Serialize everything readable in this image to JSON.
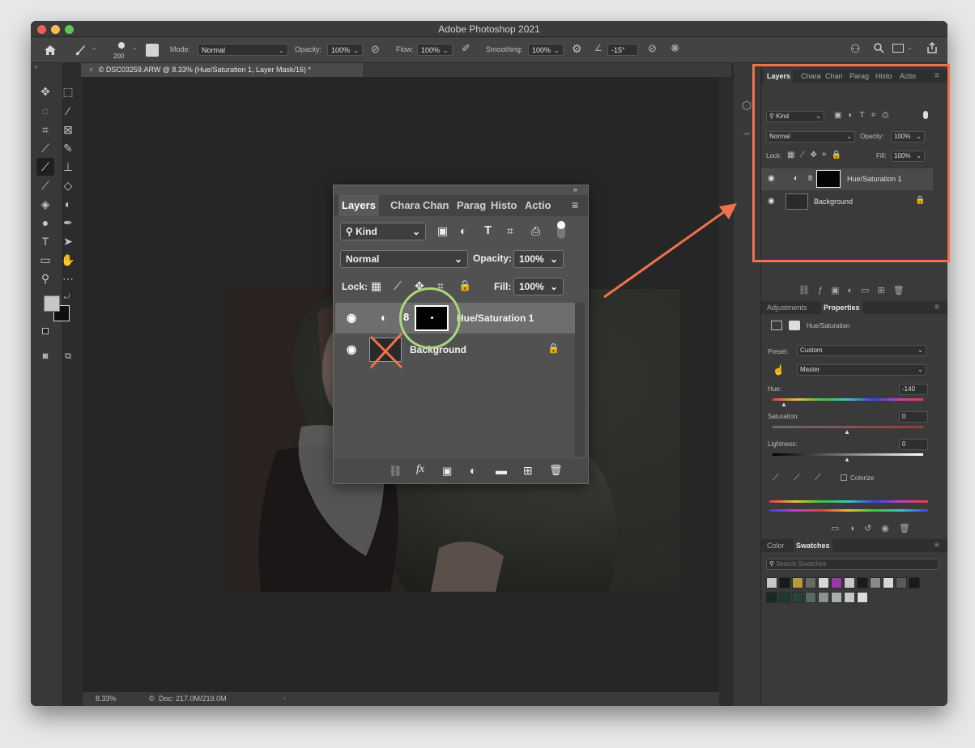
{
  "app": {
    "title": "Adobe Photoshop 2021",
    "document_tab": "© DSC03259.ARW @ 8.33% (Hue/Saturation 1, Layer Mask/16) *"
  },
  "options_bar": {
    "brush_size": "200",
    "mode_label": "Mode:",
    "mode_value": "Normal",
    "opacity_label": "Opacity:",
    "opacity_value": "100%",
    "flow_label": "Flow:",
    "flow_value": "100%",
    "smoothing_label": "Smoothing:",
    "smoothing_value": "100%",
    "angle_value": "-15°"
  },
  "status_bar": {
    "zoom": "8.33%",
    "doc_size": "Doc: 217.0M/219.0M"
  },
  "layers_panel": {
    "tabs": [
      "Layers",
      "Chara",
      "Chan",
      "Parag",
      "Histo",
      "Actio"
    ],
    "kind_label": "Kind",
    "blend_mode": "Normal",
    "opacity_label": "Opacity:",
    "opacity_value": "100%",
    "lock_label": "Lock:",
    "fill_label": "Fill:",
    "fill_value": "100%",
    "layers": [
      {
        "name": "Hue/Saturation 1",
        "selected": true
      },
      {
        "name": "Background",
        "selected": false
      }
    ]
  },
  "properties_panel": {
    "tabs": [
      "Adjustments",
      "Properties"
    ],
    "title": "Hue/Saturation",
    "preset_label": "Preset:",
    "preset_value": "Custom",
    "channel_value": "Master",
    "hue_label": "Hue:",
    "hue_value": "-140",
    "saturation_label": "Saturation:",
    "saturation_value": "0",
    "lightness_label": "Lightness:",
    "lightness_value": "0",
    "colorize_label": "Colorize"
  },
  "swatches_panel": {
    "tabs": [
      "Color",
      "Swatches"
    ],
    "search_placeholder": "Search Swatches",
    "swatches_row1": [
      "#c8c8c8",
      "#1a1a1a",
      "#b79a3a",
      "#6a6a6a",
      "#d8d8d8",
      "#9a3aa8",
      "#c8c8c8",
      "#1a1a1a",
      "#8a8a8a",
      "#d8d8d8",
      "#5a5a5a",
      "#1a1a1a"
    ],
    "swatches_row2": [
      "#1a2a24",
      "#213a30",
      "#27443a",
      "#5a6a66",
      "#8a9490",
      "#a8b0ae",
      "#c4c8c8",
      "#dcdcdc"
    ]
  },
  "colors": {
    "callout": "#f0724d",
    "mask_highlight": "#a8d87a"
  }
}
